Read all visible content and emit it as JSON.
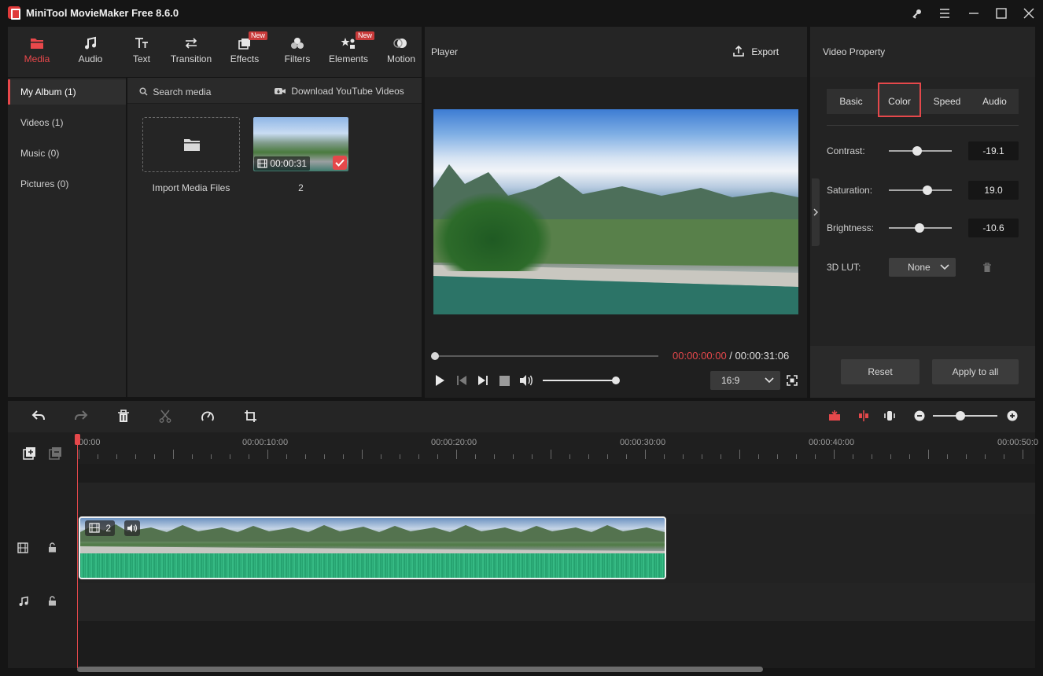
{
  "app": {
    "title": "MiniTool MovieMaker Free 8.6.0",
    "window_icons": [
      "key-icon",
      "menu-icon",
      "minimize-icon",
      "maximize-icon",
      "close-icon"
    ]
  },
  "toolbar": {
    "items": [
      {
        "label": "Media",
        "icon": "folder-icon",
        "active": true
      },
      {
        "label": "Audio",
        "icon": "music-note-icon"
      },
      {
        "label": "Text",
        "icon": "text-icon"
      },
      {
        "label": "Transition",
        "icon": "transition-arrows-icon"
      },
      {
        "label": "Effects",
        "icon": "effects-icon",
        "badge": "New"
      },
      {
        "label": "Filters",
        "icon": "filters-icon"
      },
      {
        "label": "Elements",
        "icon": "elements-icon",
        "badge": "New"
      },
      {
        "label": "Motion",
        "icon": "motion-icon"
      }
    ]
  },
  "media_nav": {
    "items": [
      {
        "label": "My Album (1)",
        "active": true
      },
      {
        "label": "Videos (1)"
      },
      {
        "label": "Music (0)"
      },
      {
        "label": "Pictures (0)"
      }
    ]
  },
  "media": {
    "search_label": "Search media",
    "download_label": "Download YouTube Videos",
    "import_label": "Import Media Files",
    "clip_duration": "00:00:31",
    "clip_name": "2"
  },
  "player": {
    "title": "Player",
    "export_label": "Export",
    "current_time": "00:00:00:00",
    "total_time": " / 00:00:31:06",
    "aspect": "16:9",
    "progress": 0,
    "volume": 1.0
  },
  "properties": {
    "title": "Video Property",
    "tabs": [
      {
        "label": "Basic"
      },
      {
        "label": "Color",
        "active": true
      },
      {
        "label": "Speed"
      },
      {
        "label": "Audio"
      }
    ],
    "contrast": {
      "label": "Contrast:",
      "value": "-19.1"
    },
    "saturation": {
      "label": "Saturation:",
      "value": "19.0"
    },
    "brightness": {
      "label": "Brightness:",
      "value": "-10.6"
    },
    "lut": {
      "label": "3D LUT:",
      "value": "None"
    },
    "reset_label": "Reset",
    "apply_all_label": "Apply to all"
  },
  "timeline": {
    "ruler_labels": [
      "00:00",
      "00:00:10:00",
      "00:00:20:00",
      "00:00:30:00",
      "00:00:40:00",
      "00:00:50:0"
    ],
    "clip_index": "2",
    "accent": "#e5484b",
    "audio_wave_color": "#2fb07c"
  }
}
